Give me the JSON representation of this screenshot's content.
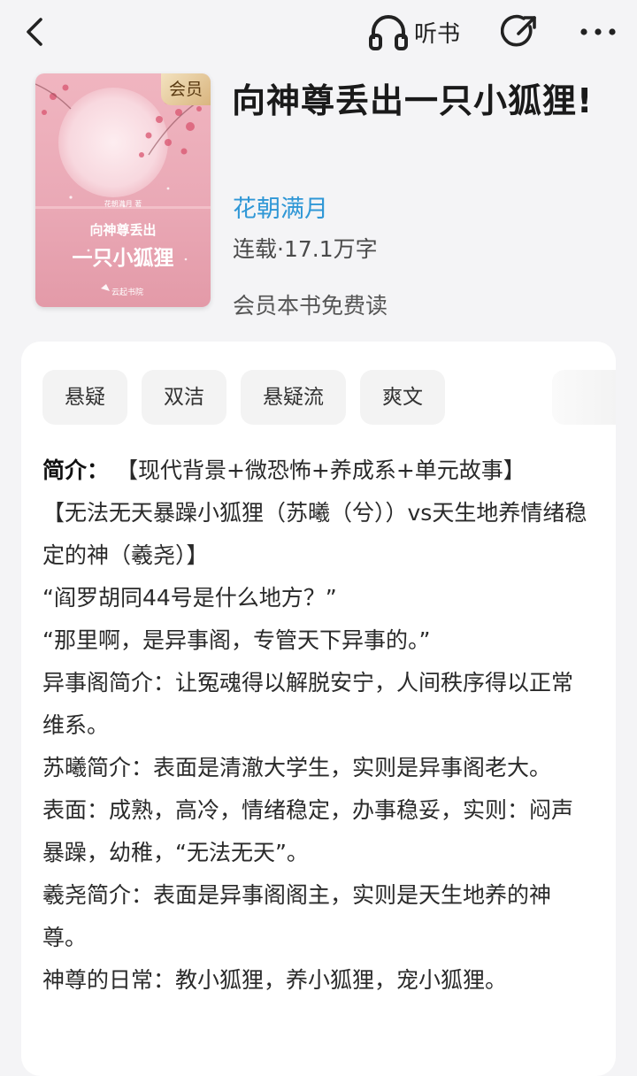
{
  "topbar": {
    "back_icon": "chevron-left-icon",
    "listen_label": "听书",
    "listen_icon": "headphones-icon",
    "share_icon": "share-icon",
    "more_icon": "more-dots-icon"
  },
  "book": {
    "cover_badge": "会员",
    "cover_author": "花朝满月 著",
    "cover_title_line1": "向神尊丢出",
    "cover_title_line2": "一只小狐狸",
    "cover_publisher": "云起书院",
    "title": "向神尊丢出一只小狐狸!",
    "author": "花朝满月",
    "status": "连载·17.1万字",
    "member_free": "会员本书免费读"
  },
  "tags": [
    "悬疑",
    "双洁",
    "悬疑流",
    "爽文"
  ],
  "intro": {
    "label": "简介：",
    "first_line": "【现代背景+微恐怖+养成系+单元故事】",
    "paragraphs": [
      "【无法无天暴躁小狐狸（苏曦（兮））vs天生地养情绪稳定的神（羲尧）】",
      "“阎罗胡同44号是什么地方？”",
      "“那里啊，是异事阁，专管天下异事的。”",
      "异事阁简介：让冤魂得以解脱安宁，人间秩序得以正常维系。",
      "苏曦简介：表面是清澈大学生，实则是异事阁老大。",
      "表面：成熟，高冷，情绪稳定，办事稳妥，实则：闷声暴躁，幼稚，“无法无天”。",
      "羲尧简介：表面是异事阁阁主，实则是天生地养的神尊。",
      "神尊的日常：教小狐狸，养小狐狸，宠小狐狸。"
    ]
  },
  "colors": {
    "author_link": "#2f97d6",
    "background": "#f4f4f6",
    "card": "#ffffff",
    "tag_bg": "#f3f3f3",
    "cover_pink": "#e9a3b0"
  }
}
